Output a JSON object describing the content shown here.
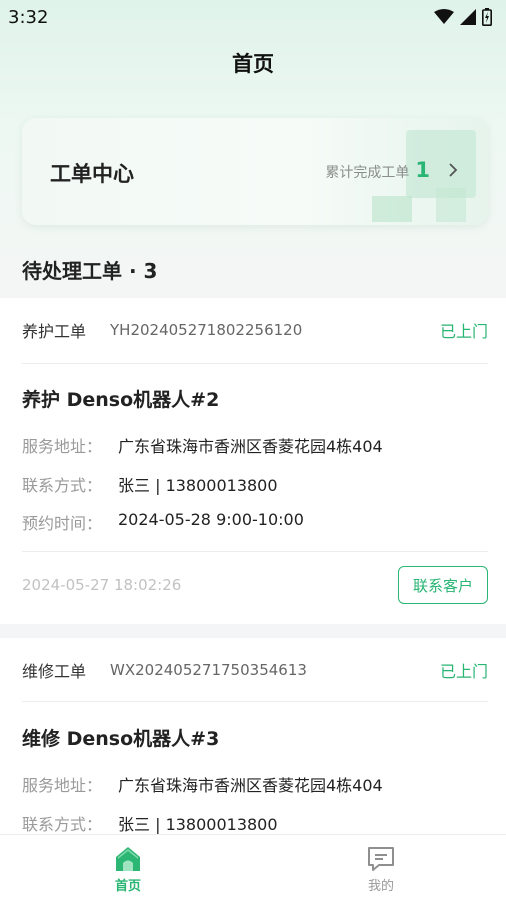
{
  "status_bar": {
    "time": "3:32"
  },
  "header": {
    "title": "首页"
  },
  "work_center": {
    "title": "工单中心",
    "completed_label": "累计完成工单",
    "completed_count": "1"
  },
  "pending": {
    "title": "待处理工单 · 3"
  },
  "orders": [
    {
      "type": "养护工单",
      "number": "YH202405271802256120",
      "status": "已上门",
      "title": "养护 Denso机器人#2",
      "address_label": "服务地址：",
      "address": "广东省珠海市香洲区香菱花园4栋404",
      "contact_label": "联系方式：",
      "contact": "张三 | 13800013800",
      "appointment_label": "预约时间：",
      "appointment": "2024-05-28 9:00-10:00",
      "created_time": "2024-05-27 18:02:26",
      "action": "联系客户"
    },
    {
      "type": "维修工单",
      "number": "WX202405271750354613",
      "status": "已上门",
      "title": "维修 Denso机器人#3",
      "address_label": "服务地址：",
      "address": "广东省珠海市香洲区香菱花园4栋404",
      "contact_label": "联系方式：",
      "contact": "张三 | 13800013800"
    }
  ],
  "tab_bar": {
    "home": "首页",
    "mine": "我的"
  },
  "colors": {
    "accent": "#29b573",
    "muted": "#9a9a9a"
  },
  "icons": [
    "wifi-icon",
    "signal-icon",
    "battery-icon",
    "chevron-right-icon",
    "home-icon",
    "message-icon"
  ]
}
